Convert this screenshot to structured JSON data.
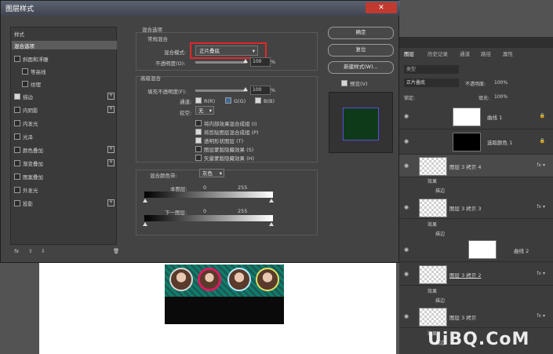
{
  "dialog": {
    "title": "图层样式",
    "close_label": "✕"
  },
  "styles_list": {
    "header": "样式",
    "items": [
      {
        "label": "混合选项",
        "checkbox": false,
        "checked": false,
        "plus": false,
        "selected": true
      },
      {
        "label": "斜面和浮雕",
        "checkbox": true,
        "checked": false,
        "plus": false
      },
      {
        "label": "等高线",
        "checkbox": true,
        "checked": false,
        "plus": false,
        "indent": true
      },
      {
        "label": "纹理",
        "checkbox": true,
        "checked": false,
        "plus": false,
        "indent": true
      },
      {
        "label": "描边",
        "checkbox": true,
        "checked": true,
        "plus": true
      },
      {
        "label": "内阴影",
        "checkbox": true,
        "checked": false,
        "plus": true
      },
      {
        "label": "内发光",
        "checkbox": true,
        "checked": false,
        "plus": false
      },
      {
        "label": "光泽",
        "checkbox": true,
        "checked": false,
        "plus": false
      },
      {
        "label": "颜色叠加",
        "checkbox": true,
        "checked": false,
        "plus": true
      },
      {
        "label": "渐变叠加",
        "checkbox": true,
        "checked": false,
        "plus": true
      },
      {
        "label": "图案叠加",
        "checkbox": true,
        "checked": false,
        "plus": false
      },
      {
        "label": "外发光",
        "checkbox": true,
        "checked": false,
        "plus": false
      },
      {
        "label": "投影",
        "checkbox": true,
        "checked": false,
        "plus": true
      }
    ],
    "footer_fx": "fx"
  },
  "blending": {
    "section_title": "混合选项",
    "general_title": "常规混合",
    "mode_label": "混合模式:",
    "mode_value": "正片叠底",
    "opacity_label": "不透明度(O):",
    "opacity_value": "100",
    "percent": "%",
    "advanced_title": "高级混合",
    "fill_label": "填充不透明度(F):",
    "fill_value": "100",
    "channels_label": "通道:",
    "channel_r": "R(R)",
    "channel_g": "G(G)",
    "channel_b": "B(B)",
    "knockout_label": "挖空:",
    "knockout_value": "无",
    "opt1": "将内部效果混合成组 (I)",
    "opt2": "将剪贴图层混合成组 (P)",
    "opt3": "透明形状图层 (T)",
    "opt4": "图层蒙版隐藏效果 (S)",
    "opt5": "矢量蒙版隐藏效果 (H)",
    "blendif_label": "混合颜色带:",
    "blendif_value": "灰色",
    "this_layer": "本图层:",
    "under_layer": "下一图层:",
    "v0": "0",
    "v255": "255"
  },
  "buttons": {
    "ok": "确定",
    "reset": "复位",
    "new_style": "新建样式(W)...",
    "preview_label": "预览(V)"
  },
  "colors": {
    "preview_fill": "#0f3a1a",
    "preview_border": "#5a4ae0"
  },
  "layers_panel": {
    "tabs": [
      "图层",
      "历史记录",
      "通道",
      "路径",
      "属性"
    ],
    "search": "类型",
    "blend_mode": "正片叠底",
    "opacity_label": "不透明度:",
    "opacity_value": "100%",
    "lock_label": "锁定:",
    "fill_label": "填充:",
    "fill_value": "100%",
    "rows": [
      {
        "name": "曲线 1",
        "fx": false
      },
      {
        "name": "选取颜色 1",
        "fx": false
      },
      {
        "name": "图层 3 拷贝 4",
        "fx": true,
        "selected": true
      },
      {
        "name": "效果",
        "sub": true
      },
      {
        "name": "描边",
        "sub": true
      },
      {
        "name": "图层 3 拷贝 3",
        "fx": true
      },
      {
        "name": "效果",
        "sub": true
      },
      {
        "name": "描边",
        "sub": true
      },
      {
        "name": "曲线 2",
        "fx": false
      },
      {
        "name": "图层 3 拷贝 2",
        "fx": true
      },
      {
        "name": "效果",
        "sub": true
      },
      {
        "name": "描边",
        "sub": true
      },
      {
        "name": "图层 3 拷贝",
        "fx": true
      },
      {
        "name": "效果",
        "sub": true
      },
      {
        "name": "描边",
        "sub": true
      }
    ]
  },
  "watermark": "UiBQ.CoM"
}
